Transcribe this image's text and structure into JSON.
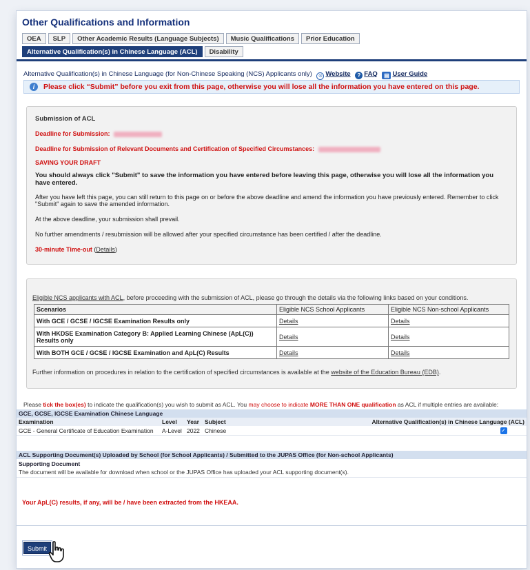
{
  "page": {
    "title": "Other Qualifications and Information"
  },
  "tabs": [
    {
      "label": "OEA"
    },
    {
      "label": "SLP"
    },
    {
      "label": "Other Academic Results (Language Subjects)"
    },
    {
      "label": "Music Qualifications"
    },
    {
      "label": "Prior Education"
    },
    {
      "label": "Alternative Qualification(s) in Chinese Language (ACL)"
    },
    {
      "label": "Disability"
    }
  ],
  "section": {
    "heading": "Alternative Qualification(s) in Chinese Language (for Non-Chinese Speaking (NCS) Applicants only)",
    "links": {
      "website": "Website",
      "faq": "FAQ",
      "guide": "User Guide"
    }
  },
  "warning": "Please click “Submit” before you exit from this page, otherwise you will lose all the information you have entered on this page.",
  "submission": {
    "title": "Submission of ACL",
    "deadline_label": "Deadline for Submission:",
    "deadline_docs_label": "Deadline for Submission of Relevant Documents and Certification of Specified Circumstances:",
    "saving_heading": "SAVING YOUR DRAFT",
    "saving_bold": "You should always click \"Submit\" to save the information you have entered before leaving this page, otherwise you will lose all the information you have entered.",
    "return_text": "After you have left this page, you can still return to this page on or before the above deadline and amend the information you have previously entered. Remember to click \"Submit\" again to save the amended information.",
    "prevail_text": "At the above deadline, your submission shall prevail.",
    "no_amend_text": "No further amendments / resubmission will be allowed after your specified circumstance has been certified / after the deadline.",
    "timeout_label": "30-minute Time-out",
    "timeout_link": "Details"
  },
  "eligibility": {
    "intro_link": "Eligible NCS applicants with ACL",
    "intro_rest": ", before proceeding with the submission of ACL, please go through the details via the following links based on your conditions.",
    "headers": {
      "scenarios": "Scenarios",
      "school": "Eligible NCS School Applicants",
      "nonschool": "Eligible NCS Non-school Applicants"
    },
    "rows": [
      {
        "scenario": "With GCE / GCSE / IGCSE Examination Results only",
        "school": "Details",
        "nonschool": "Details"
      },
      {
        "scenario": "With HKDSE Examination Category B: Applied Learning Chinese (ApL(C)) Results only",
        "school": "Details",
        "nonschool": "Details"
      },
      {
        "scenario": "With BOTH GCE / GCSE / IGCSE Examination and ApL(C) Results",
        "school": "Details",
        "nonschool": "Details"
      }
    ],
    "footer_text": "Further information on procedures in relation to the certification of specified circumstances is available at the",
    "footer_link": "website of the Education Bureau (EDB)"
  },
  "tick_note": {
    "prefix": "Please",
    "tick": "tick the box(es)",
    "mid": "to indicate the qualification(s) you wish to submit as ACL. You",
    "may": "may choose to indicate",
    "more": "MORE THAN ONE qualification",
    "suffix": "as ACL if multiple entries are available:"
  },
  "qualifications": {
    "bar": "GCE, GCSE, IGCSE Examination Chinese Language",
    "headers": {
      "exam": "Examination",
      "level": "Level",
      "year": "Year",
      "subject": "Subject",
      "acl": "Alternative Qualification(s) in Chinese Language (ACL)"
    },
    "rows": [
      {
        "exam": "GCE - General Certificate of Education Examination",
        "level": "A-Level",
        "year": "2022",
        "subject": "Chinese",
        "checked": true
      }
    ]
  },
  "support": {
    "bar": "ACL Supporting Document(s) Uploaded by School (for School Applicants) / Submitted to the JUPAS Office (for Non-school Applicants)",
    "heading": "Supporting Document",
    "text": "The document will be available for download when school or the JUPAS Office has uploaded your ACL supporting document(s)."
  },
  "apl_note": "Your ApL(C) results, if any, will be / have been extracted from the HKEAA.",
  "submit_label": "Submit",
  "colors": {
    "primary": "#1e3f7a",
    "alert": "#d01010",
    "title": "#14307a",
    "bar": "#d3dfef"
  }
}
